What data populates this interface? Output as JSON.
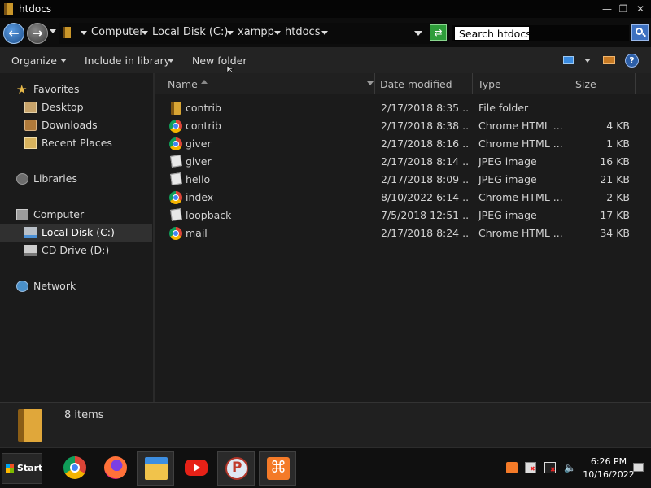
{
  "window": {
    "title": "htdocs"
  },
  "address": {
    "crumbs": [
      "Computer",
      "Local Disk (C:)",
      "xampp",
      "htdocs"
    ]
  },
  "search": {
    "value": "Search htdocs"
  },
  "toolbar": {
    "organize": "Organize",
    "include": "Include in library",
    "new_folder": "New folder"
  },
  "nav": {
    "favorites": "Favorites",
    "desktop": "Desktop",
    "downloads": "Downloads",
    "recent": "Recent Places",
    "libraries": "Libraries",
    "computer": "Computer",
    "local_disk": "Local Disk (C:)",
    "cd_drive": "CD Drive (D:)",
    "network": "Network"
  },
  "columns": {
    "name": "Name",
    "date": "Date modified",
    "type": "Type",
    "size": "Size"
  },
  "files": [
    {
      "icon": "folder-icon",
      "name": "contrib",
      "date": "2/17/2018 8:35 ...",
      "type": "File folder",
      "size": ""
    },
    {
      "icon": "chrome-html-icon",
      "name": "contrib",
      "date": "2/17/2018 8:38 ...",
      "type": "Chrome HTML ...",
      "size": "4 KB"
    },
    {
      "icon": "chrome-html-icon",
      "name": "giver",
      "date": "2/17/2018 8:16 ...",
      "type": "Chrome HTML ...",
      "size": "1 KB"
    },
    {
      "icon": "jpeg-image-icon",
      "name": "giver",
      "date": "2/17/2018 8:14 ...",
      "type": "JPEG image",
      "size": "16 KB"
    },
    {
      "icon": "jpeg-image-icon",
      "name": "hello",
      "date": "2/17/2018 8:09 ...",
      "type": "JPEG image",
      "size": "21 KB"
    },
    {
      "icon": "chrome-html-icon",
      "name": "index",
      "date": "8/10/2022 6:14 ...",
      "type": "Chrome HTML ...",
      "size": "2 KB"
    },
    {
      "icon": "jpeg-image-icon",
      "name": "loopback",
      "date": "7/5/2018 12:51 ...",
      "type": "JPEG image",
      "size": "17 KB"
    },
    {
      "icon": "chrome-html-icon",
      "name": "mail",
      "date": "2/17/2018 8:24 ...",
      "type": "Chrome HTML ...",
      "size": "34 KB"
    }
  ],
  "details": {
    "count": "8 items"
  },
  "taskbar": {
    "start": "Start",
    "apps": [
      "chrome-icon",
      "firefox-icon",
      "file-explorer-icon",
      "youtube-icon",
      "postman-icon",
      "xampp-icon"
    ],
    "time": "6:26 PM",
    "date": "10/16/2022"
  },
  "colors": {
    "background": "#1b1b1b",
    "selection": "#303030",
    "accent": "#3e71c0"
  }
}
